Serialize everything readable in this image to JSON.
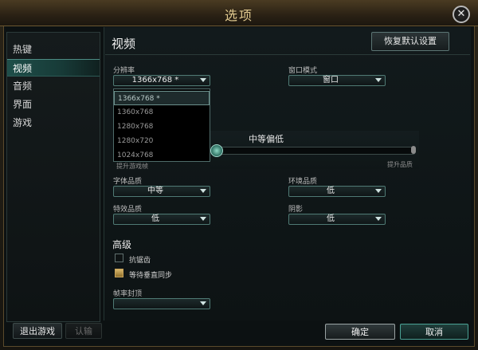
{
  "window": {
    "title": "选项"
  },
  "sidebar": {
    "items": [
      {
        "label": "热键",
        "active": false
      },
      {
        "label": "视频",
        "active": true
      },
      {
        "label": "音频",
        "active": false
      },
      {
        "label": "界面",
        "active": false
      },
      {
        "label": "游戏",
        "active": false
      }
    ]
  },
  "video": {
    "title": "视频",
    "restore_defaults": "恢复默认设置",
    "resolution": {
      "label": "分辨率",
      "value": "1366x768 *",
      "options": [
        "1366x768 *",
        "1360x768",
        "1280x768",
        "1280x720",
        "1024x768"
      ],
      "selected_index": 0
    },
    "window_mode": {
      "label": "窗口模式",
      "value": "窗口"
    },
    "quality": {
      "label": "中等偏低",
      "level": 0.0,
      "left_caption": "提升游戏帧",
      "right_caption": "提升品质"
    },
    "font_quality": {
      "label": "字体品质",
      "value": "中等"
    },
    "environment_quality": {
      "label": "环境品质",
      "value": "低"
    },
    "effects_quality": {
      "label": "特效品质",
      "value": "低"
    },
    "shadows": {
      "label": "阴影",
      "value": "低"
    },
    "advanced": {
      "title": "高级",
      "antialiasing": {
        "label": "抗锯齿",
        "checked": false
      },
      "vsync": {
        "label": "等待垂直同步",
        "checked": true
      },
      "frame_cap": {
        "label": "帧率封顶",
        "value": ""
      }
    }
  },
  "footer": {
    "quit": "退出游戏",
    "surrender": "认输",
    "ok": "确定",
    "cancel": "取消"
  },
  "colors": {
    "accent": "#4aa194",
    "title_gold": "#e0c98f"
  }
}
